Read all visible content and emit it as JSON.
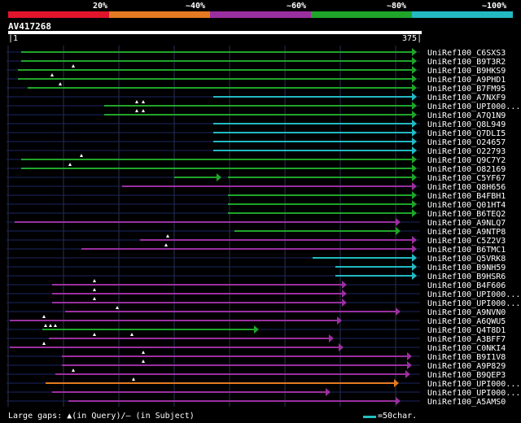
{
  "legend": {
    "colors": [
      "#e0142b",
      "#e57a22",
      "#9a2fa0",
      "#1fa52a",
      "#22b9c2"
    ],
    "labels": [
      "20%",
      "~40%",
      "~60%",
      "~80%",
      "~100%"
    ]
  },
  "query": {
    "id": "AV417268",
    "start": "1",
    "end": "375"
  },
  "hits": [
    {
      "name": "UniRef100_C6SXS3",
      "color": "#1fa52a"
    },
    {
      "name": "UniRef100_B9T3R2",
      "color": "#1fa52a"
    },
    {
      "name": "UniRef100_B9HKS9",
      "color": "#1fa52a"
    },
    {
      "name": "UniRef100_A9PHD1",
      "color": "#1fa52a"
    },
    {
      "name": "UniRef100_B7FM95",
      "color": "#1fa52a"
    },
    {
      "name": "UniRef100_A7NXF9",
      "color": "#22b9c2"
    },
    {
      "name": "UniRef100_UPI000...",
      "color": "#1fa52a"
    },
    {
      "name": "UniRef100_A7Q1N9",
      "color": "#1fa52a"
    },
    {
      "name": "UniRef100_Q8L949",
      "color": "#22b9c2"
    },
    {
      "name": "UniRef100_Q7DLI5",
      "color": "#22b9c2"
    },
    {
      "name": "UniRef100_O24657",
      "color": "#22b9c2"
    },
    {
      "name": "UniRef100_O22793",
      "color": "#22b9c2"
    },
    {
      "name": "UniRef100_Q9C7Y2",
      "color": "#1fa52a"
    },
    {
      "name": "UniRef100_O82169",
      "color": "#1fa52a"
    },
    {
      "name": "UniRef100_C5YF67",
      "color": "#1fa52a"
    },
    {
      "name": "UniRef100_Q8H656",
      "color": "#9a2fa0"
    },
    {
      "name": "UniRef100_B4FBH1",
      "color": "#1fa52a"
    },
    {
      "name": "UniRef100_Q01HT4",
      "color": "#1fa52a"
    },
    {
      "name": "UniRef100_B6TEQ2",
      "color": "#1fa52a"
    },
    {
      "name": "UniRef100_A9NLQ7",
      "color": "#9a2fa0"
    },
    {
      "name": "UniRef100_A9NTP8",
      "color": "#1fa52a"
    },
    {
      "name": "UniRef100_C5Z2V3",
      "color": "#9a2fa0"
    },
    {
      "name": "UniRef100_B6TMC1",
      "color": "#9a2fa0"
    },
    {
      "name": "UniRef100_Q5VRK8",
      "color": "#22b9c2"
    },
    {
      "name": "UniRef100_B9NH59",
      "color": "#22b9c2"
    },
    {
      "name": "UniRef100_B9HSR6",
      "color": "#22b9c2"
    },
    {
      "name": "UniRef100_B4F606",
      "color": "#9a2fa0"
    },
    {
      "name": "UniRef100_UPI000...",
      "color": "#9a2fa0"
    },
    {
      "name": "UniRef100_UPI000...",
      "color": "#9a2fa0"
    },
    {
      "name": "UniRef100_A9NVN0",
      "color": "#9a2fa0"
    },
    {
      "name": "UniRef100_A6QWU5",
      "color": "#9a2fa0"
    },
    {
      "name": "UniRef100_Q4T8D1",
      "color": "#1fa52a"
    },
    {
      "name": "UniRef100_A3BFF7",
      "color": "#9a2fa0"
    },
    {
      "name": "UniRef100_C0NKI4",
      "color": "#9a2fa0"
    },
    {
      "name": "UniRef100_B9I1V8",
      "color": "#9a2fa0"
    },
    {
      "name": "UniRef100_A9P829",
      "color": "#9a2fa0"
    },
    {
      "name": "UniRef100_B9QEP3",
      "color": "#9a2fa0"
    },
    {
      "name": "UniRef100_UPI000...",
      "color": "#e57a22"
    },
    {
      "name": "UniRef100_UPI000...",
      "color": "#9a2fa0"
    },
    {
      "name": "UniRef100_A5AMS0",
      "color": "#9a2fa0"
    }
  ],
  "footer": {
    "gaps_text": "Large gaps: ▲(in Query)/— (in Subject)",
    "scale_text": "=50char."
  }
}
